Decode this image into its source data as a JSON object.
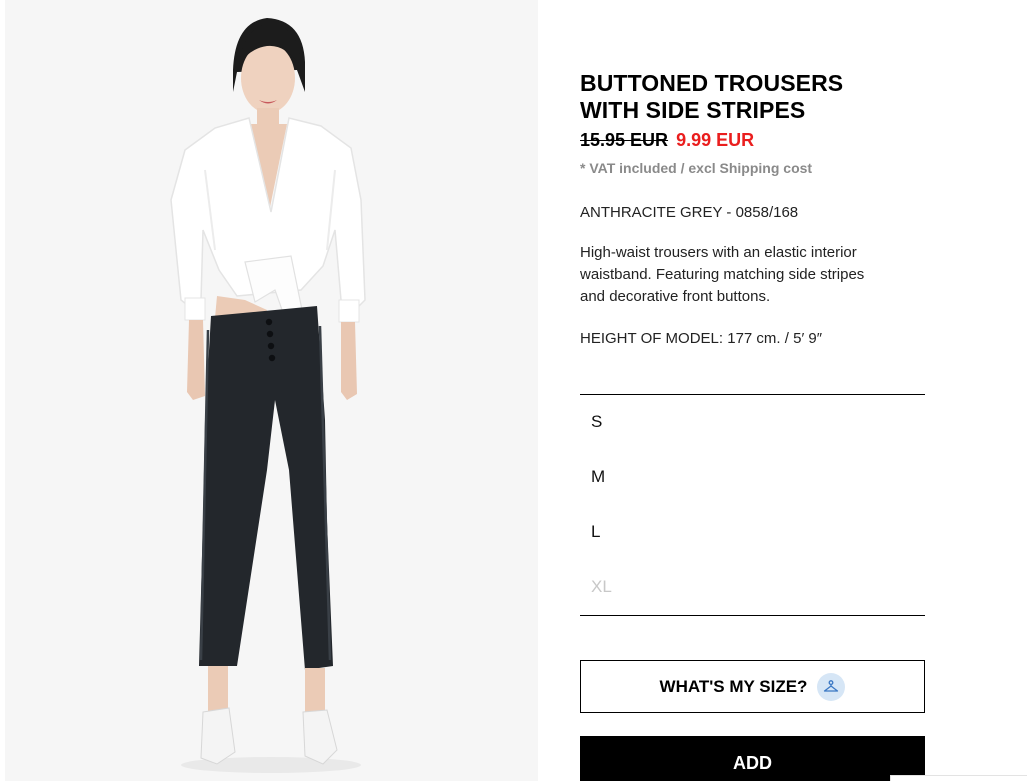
{
  "product": {
    "title_line1": "BUTTONED TROUSERS",
    "title_line2": "WITH SIDE STRIPES",
    "price_old": "15.95 EUR",
    "price_new": "9.99 EUR",
    "vat_note": "* VAT included / excl Shipping cost",
    "color_ref": "ANTHRACITE GREY - 0858/168",
    "desc_line1": "High-waist trousers with an elastic interior",
    "desc_line2": "waistband. Featuring matching side stripes",
    "desc_line3": "and decorative front buttons.",
    "model_height": "HEIGHT OF MODEL: 177 cm. / 5′ 9″"
  },
  "sizes": [
    {
      "label": "S",
      "available": true
    },
    {
      "label": "M",
      "available": true
    },
    {
      "label": "L",
      "available": true
    },
    {
      "label": "XL",
      "available": false
    }
  ],
  "actions": {
    "size_guide_label": "WHAT'S MY SIZE?",
    "size_guide_icon": "hanger-icon",
    "add_label": "ADD"
  },
  "colors": {
    "sale_price": "#ea1e1e",
    "muted_text": "#8a8a8a",
    "disabled_size": "#c8c8c8",
    "size_guide_badge": "#d6e6f6"
  }
}
